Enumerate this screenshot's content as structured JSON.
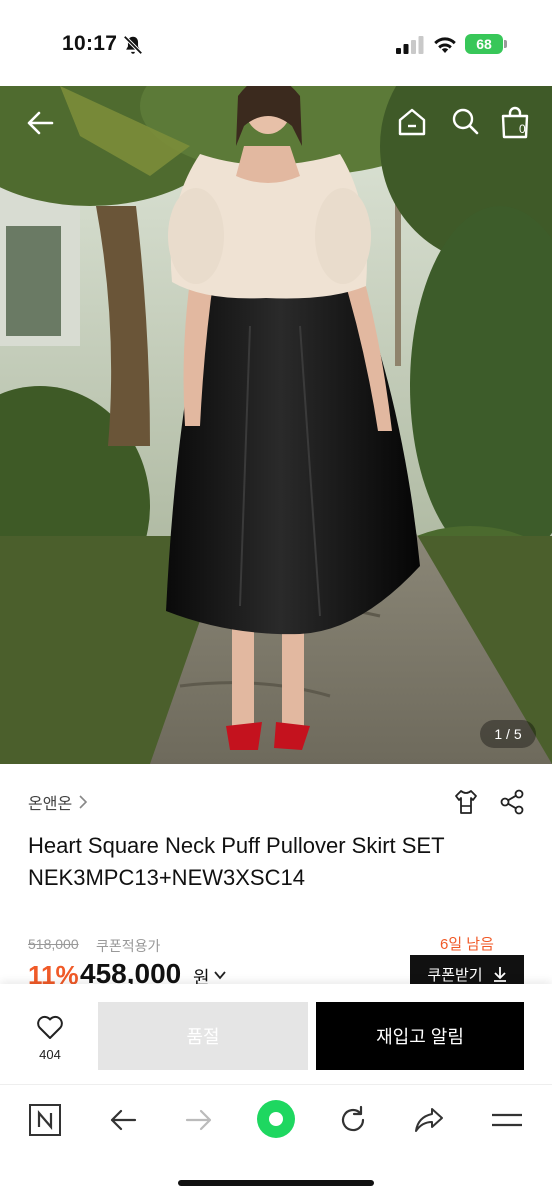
{
  "status_bar": {
    "time": "10:17",
    "battery": "68"
  },
  "hero": {
    "image_counter": "1 / 5",
    "cart_count": "0"
  },
  "product": {
    "brand": "온앤온",
    "title_line1": "Heart Square Neck Puff Pullover Skirt SET",
    "title_line2": "NEK3MPC13+NEW3XSC14",
    "original_price": "518,000",
    "coupon_applicable": "쿠폰적용가",
    "days_left": "6일 남음",
    "discount": "11%",
    "price": "458,000",
    "currency": "원",
    "coupon_button": "쿠폰받기"
  },
  "purchase_bar": {
    "like_count": "404",
    "soldout_label": "품절",
    "restock_label": "재입고 알림"
  },
  "colors": {
    "accent_orange": "#f05a28",
    "battery_green": "#38c759",
    "browser_green": "#1ed760"
  },
  "icons": [
    "bell-slash-icon",
    "signal-icon",
    "wifi-icon",
    "back-arrow-icon",
    "home-icon",
    "search-icon",
    "shopping-bag-icon",
    "chevron-right-icon",
    "clothing-size-icon",
    "share-icon",
    "chevron-down-icon",
    "download-arrow-icon",
    "heart-icon",
    "naver-n-icon",
    "browser-back-icon",
    "browser-forward-icon",
    "green-circle-icon",
    "refresh-icon",
    "share-arrow-icon",
    "menu-icon"
  ]
}
